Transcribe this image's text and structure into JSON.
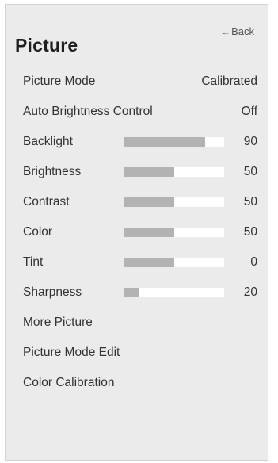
{
  "header": {
    "back_label": "Back",
    "title": "Picture"
  },
  "menu": {
    "picture_mode": {
      "label": "Picture Mode",
      "value": "Calibrated"
    },
    "auto_brightness": {
      "label": "Auto Brightness Control",
      "value": "Off"
    },
    "backlight": {
      "label": "Backlight",
      "value": "90",
      "level": 0.81
    },
    "brightness": {
      "label": "Brightness",
      "value": "50",
      "level": 0.5
    },
    "contrast": {
      "label": "Contrast",
      "value": "50",
      "level": 0.5
    },
    "color": {
      "label": "Color",
      "value": "50",
      "level": 0.5
    },
    "tint": {
      "label": "Tint",
      "value": "0",
      "level": 0.5
    },
    "sharpness": {
      "label": "Sharpness",
      "value": "20",
      "level": 0.14
    },
    "more_picture": {
      "label": "More Picture"
    },
    "picture_mode_edit": {
      "label": "Picture Mode Edit"
    },
    "color_calibration": {
      "label": "Color Calibration"
    }
  },
  "colors": {
    "panel_bg": "#ebebeb",
    "bar_track": "#ffffff",
    "bar_fill": "#b3b3b3"
  }
}
